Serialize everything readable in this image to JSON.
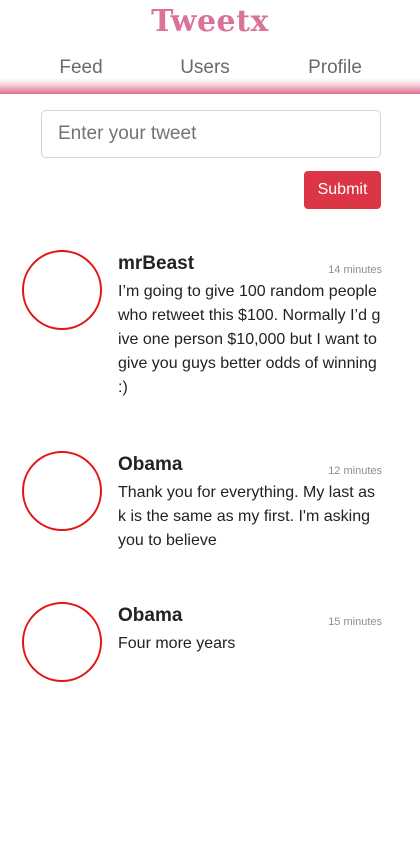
{
  "header": {
    "brand": "Tweetx",
    "tabs": [
      "Feed",
      "Users",
      "Profile"
    ]
  },
  "composer": {
    "placeholder": "Enter your tweet",
    "submit_label": "Submit"
  },
  "posts": [
    {
      "author": "mrBeast",
      "time": "14 minutes",
      "text": "I’m going to give 100 random people who retweet this $100. Normally I’d give one person $10,000 but I want to give you guys better odds of winning :)"
    },
    {
      "author": "Obama",
      "time": "12 minutes",
      "text": "Thank you for everything. My last ask is the same as my first. I'm asking you to believe"
    },
    {
      "author": "Obama",
      "time": "15 minutes",
      "text": "Four more years"
    }
  ],
  "colors": {
    "brand": "#d9739a",
    "submit": "#dc3545",
    "avatar_border": "#e31616"
  }
}
